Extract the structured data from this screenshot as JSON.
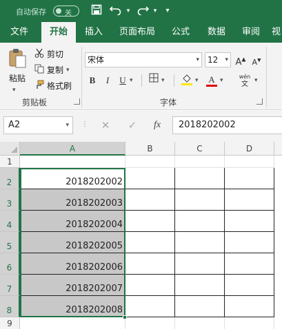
{
  "titlebar": {
    "autosave_label": "自动保存",
    "autosave_state": "关",
    "icons": [
      "save-icon",
      "undo-icon",
      "redo-icon",
      "customize-icon"
    ]
  },
  "tabs": [
    {
      "label": "文件",
      "active": false
    },
    {
      "label": "开始",
      "active": true
    },
    {
      "label": "插入",
      "active": false
    },
    {
      "label": "页面布局",
      "active": false
    },
    {
      "label": "公式",
      "active": false
    },
    {
      "label": "数据",
      "active": false
    },
    {
      "label": "审阅",
      "active": false
    },
    {
      "label": "视",
      "active": false
    }
  ],
  "ribbon": {
    "clipboard": {
      "paste": "粘贴",
      "cut": "剪切",
      "copy": "复制",
      "format_painter": "格式刷",
      "group_label": "剪贴板"
    },
    "font": {
      "font_name": "宋体",
      "font_size": "12",
      "bold": "B",
      "italic": "I",
      "underline": "U",
      "font_color_glyph": "A",
      "phonetic_top": "wén",
      "phonetic_bottom": "文",
      "group_label": "字体"
    }
  },
  "formula_bar": {
    "name_box": "A2",
    "fx": "fx",
    "value": "2018202002"
  },
  "grid": {
    "columns": [
      "A",
      "B",
      "C",
      "D"
    ],
    "rows": [
      "1",
      "2",
      "3",
      "4",
      "5",
      "6",
      "7",
      "8",
      "9"
    ],
    "a_values": [
      "",
      "2018202002",
      "2018202003",
      "2018202004",
      "2018202005",
      "2018202006",
      "2018202007",
      "2018202008"
    ]
  },
  "colors": {
    "accent": "#217346",
    "selection_shade": "#c8c8c8"
  }
}
